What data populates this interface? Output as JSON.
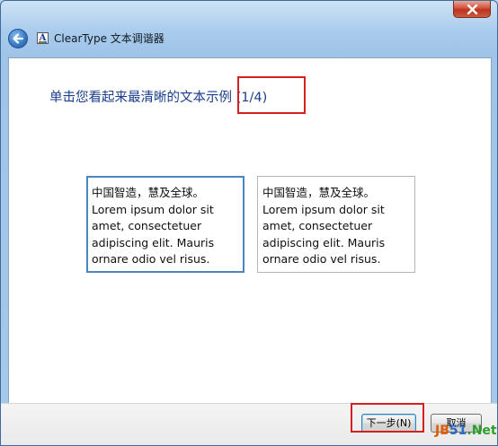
{
  "window": {
    "title": "ClearType 文本调谐器"
  },
  "main": {
    "heading": "单击您看起来最清晰的文本示例 (1/4)",
    "samples": [
      {
        "lines": [
          "中国智造，慧及全球。",
          "Lorem ipsum dolor sit",
          "amet, consectetuer",
          "adipiscing elit. Mauris",
          "ornare odio vel risus."
        ],
        "selected": true
      },
      {
        "lines": [
          "中国智造，慧及全球。",
          "Lorem ipsum dolor sit",
          "amet, consectetuer",
          "adipiscing elit. Mauris",
          "ornare odio vel risus."
        ],
        "selected": false
      }
    ]
  },
  "footer": {
    "next_label": "下一步(N)",
    "cancel_label": "取消"
  },
  "watermark": {
    "part1": "JB",
    "part2": "51",
    "part3": ".Net"
  },
  "colors": {
    "heading": "#1a3e8e",
    "highlight_box": "#d42020",
    "selected_border": "#4a86c6"
  },
  "icons": {
    "back": "back-arrow-icon",
    "close": "close-icon",
    "app": "cleartype-app-icon"
  }
}
